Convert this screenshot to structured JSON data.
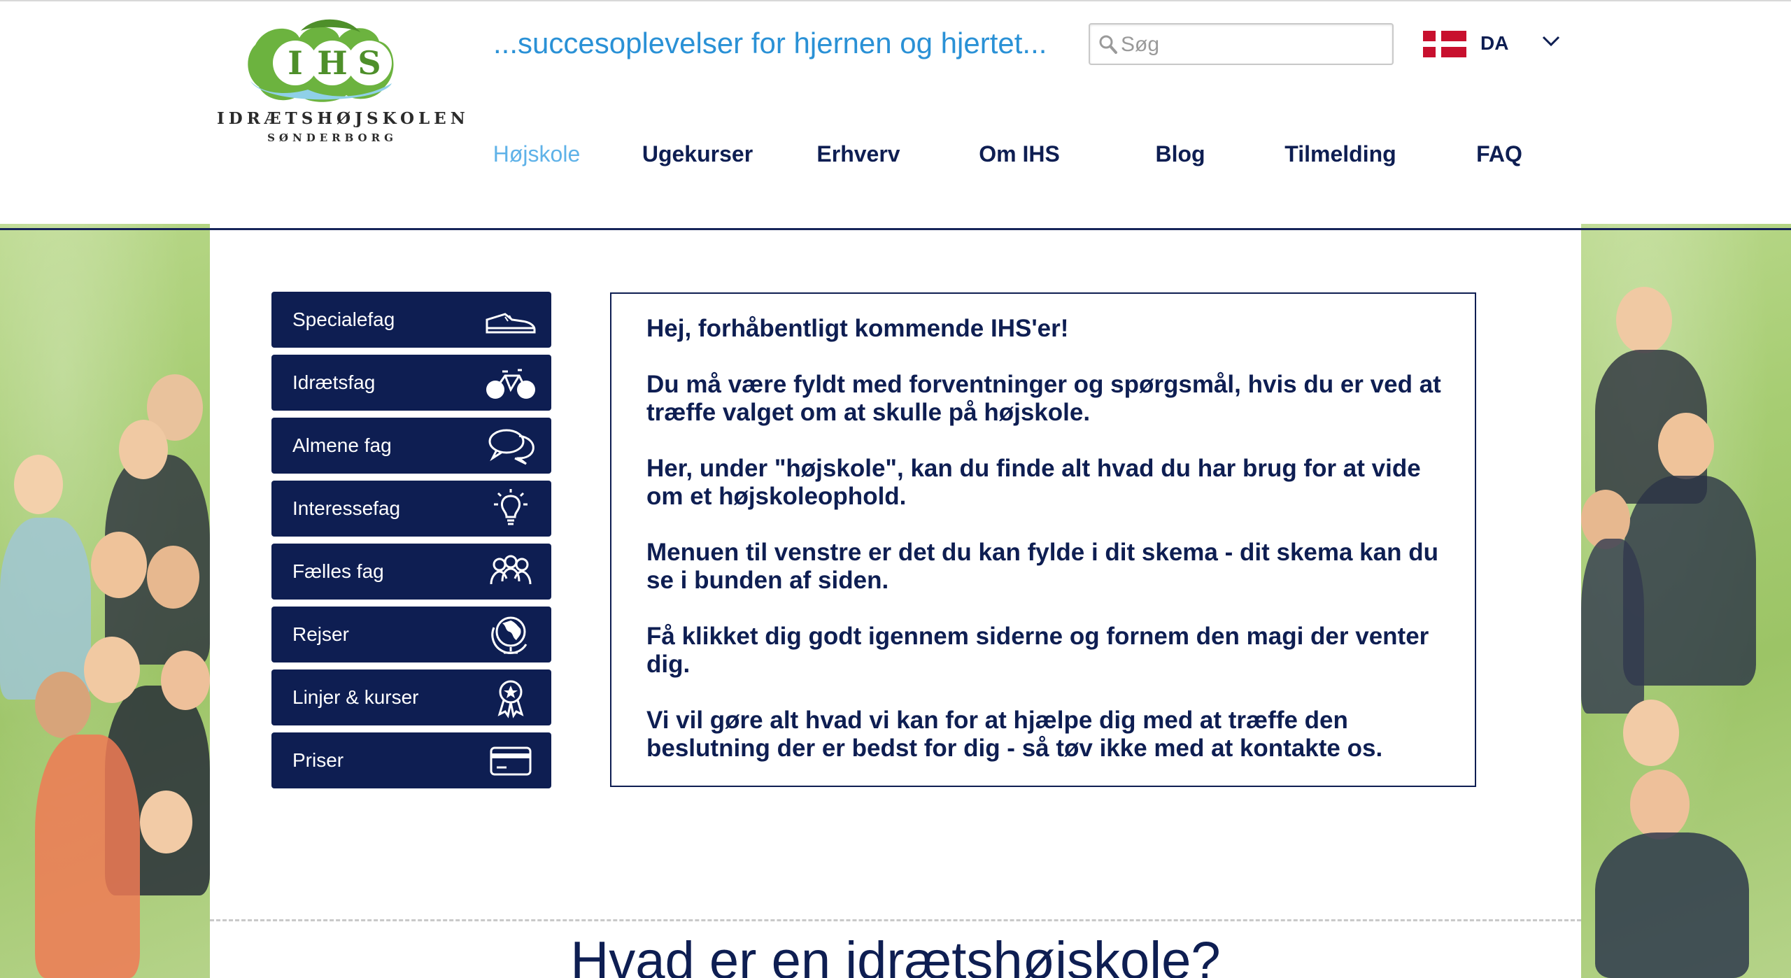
{
  "header": {
    "logo": {
      "letters": "IHS",
      "name": "IDRÆTSHØJSKOLEN",
      "city": "SØNDERBORG"
    },
    "tagline": "...succesoplevelser for hjernen og hjertet...",
    "search": {
      "placeholder": "Søg",
      "value": ""
    },
    "language": {
      "code": "DA",
      "flag": "danish-flag"
    }
  },
  "nav": {
    "items": [
      {
        "label": "Højskole",
        "active": true
      },
      {
        "label": "Ugekurser",
        "active": false
      },
      {
        "label": "Erhverv",
        "active": false
      },
      {
        "label": "Om IHS",
        "active": false
      },
      {
        "label": "Blog",
        "active": false
      },
      {
        "label": "Tilmelding",
        "active": false
      },
      {
        "label": "FAQ",
        "active": false
      }
    ]
  },
  "side_menu": {
    "items": [
      {
        "label": "Specialefag",
        "icon": "sneaker-icon"
      },
      {
        "label": "Idrætsfag",
        "icon": "bicycle-icon"
      },
      {
        "label": "Almene fag",
        "icon": "speech-bubbles-icon"
      },
      {
        "label": "Interessefag",
        "icon": "lightbulb-icon"
      },
      {
        "label": "Fælles fag",
        "icon": "group-icon"
      },
      {
        "label": "Rejser",
        "icon": "globe-icon"
      },
      {
        "label": "Linjer & kurser",
        "icon": "award-ribbon-icon"
      },
      {
        "label": "Priser",
        "icon": "credit-card-icon"
      }
    ]
  },
  "intro": {
    "paragraphs": [
      "Hej, forhåbentligt kommende IHS'er!",
      "Du må være fyldt med forventninger og spørgsmål, hvis du er ved at træffe valget om at skulle på højskole.",
      "Her, under \"højskole\", kan du finde alt hvad du har brug for at vide om et højskoleophold.",
      "Menuen til venstre er det du kan fylde i dit skema - dit skema kan du se i bunden af siden.",
      "Få klikket dig godt igennem siderne og fornem den magi der venter dig.",
      "Vi vil gøre alt hvad vi kan for at hjælpe dig med at træffe den beslutning der er bedst for dig - så tøv ikke med at kontakte os."
    ]
  },
  "section": {
    "heading": "Hvad er en idrætshøjskole?"
  },
  "colors": {
    "navy": "#0e1e52",
    "accent_blue": "#2a91d6",
    "active_nav": "#5fb2e8",
    "logo_green": "#6cb33f",
    "flag_red": "#c8102e"
  }
}
